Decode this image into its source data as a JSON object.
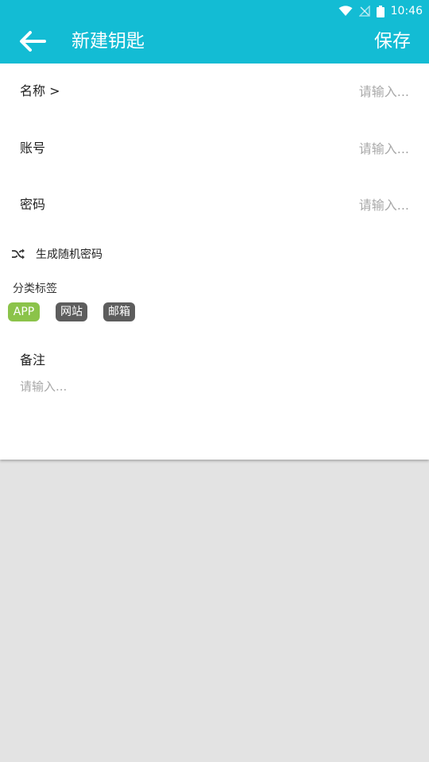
{
  "status_bar": {
    "time": "10:46"
  },
  "app_bar": {
    "title": "新建钥匙",
    "save_label": "保存"
  },
  "form": {
    "name": {
      "label": "名称 >",
      "placeholder": "请输入..."
    },
    "account": {
      "label": "账号",
      "placeholder": "请输入..."
    },
    "password": {
      "label": "密码",
      "placeholder": "请输入..."
    },
    "generate_label": "生成随机密码",
    "tags_title": "分类标签",
    "tags": [
      {
        "label": "APP",
        "selected": true
      },
      {
        "label": "网站",
        "selected": false
      },
      {
        "label": "邮箱",
        "selected": false
      }
    ],
    "notes": {
      "label": "备注",
      "placeholder": "请输入..."
    }
  },
  "colors": {
    "primary": "#13bcd4",
    "tag_active": "#8bc34a",
    "tag_default": "#5d5d5d",
    "background": "#e3e3e3"
  },
  "icons": {
    "back": "arrow-left-icon",
    "shuffle": "shuffle-icon",
    "wifi": "wifi-icon",
    "signal": "no-signal-icon",
    "battery": "battery-icon"
  }
}
